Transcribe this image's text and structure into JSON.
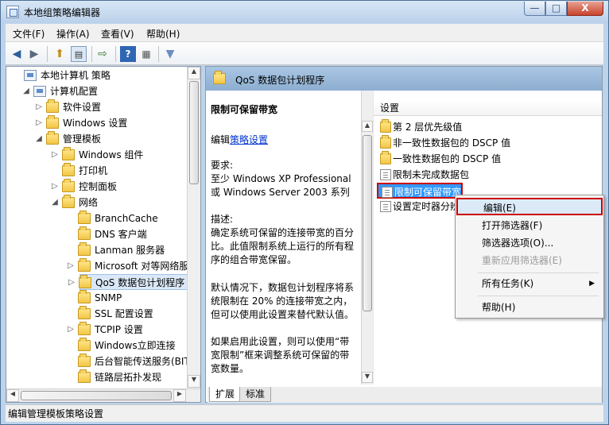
{
  "window": {
    "title": "本地组策略编辑器",
    "min_glyph": "—",
    "max_glyph": "□",
    "close_glyph": "X"
  },
  "menu": [
    "文件(F)",
    "操作(A)",
    "查看(V)",
    "帮助(H)"
  ],
  "toolbar": {
    "icons": [
      "back-arrow-icon",
      "forward-arrow-icon",
      "folder-up-icon",
      "show-hide-tree-icon",
      "export-list-icon",
      "help-icon",
      "properties-pane-icon",
      "filter-icon"
    ]
  },
  "tree": [
    {
      "label": "本地计算机 策略",
      "icon": "computer-icon",
      "expander": "",
      "level": 0
    },
    {
      "label": "计算机配置",
      "icon": "computer-icon",
      "expander": "◢",
      "level": 1
    },
    {
      "label": "软件设置",
      "icon": "folder-icon",
      "expander": "▷",
      "level": 2
    },
    {
      "label": "Windows 设置",
      "icon": "folder-icon",
      "expander": "▷",
      "level": 2
    },
    {
      "label": "管理模板",
      "icon": "folder-icon",
      "expander": "◢",
      "level": 2
    },
    {
      "label": "Windows 组件",
      "icon": "folder-icon",
      "expander": "▷",
      "level": 3
    },
    {
      "label": "打印机",
      "icon": "folder-icon",
      "expander": "",
      "level": 3
    },
    {
      "label": "控制面板",
      "icon": "folder-icon",
      "expander": "▷",
      "level": 3
    },
    {
      "label": "网络",
      "icon": "folder-icon",
      "expander": "◢",
      "level": 3
    },
    {
      "label": "BranchCache",
      "icon": "folder-icon",
      "expander": "",
      "level": 4
    },
    {
      "label": "DNS 客户端",
      "icon": "folder-icon",
      "expander": "",
      "level": 4
    },
    {
      "label": "Lanman 服务器",
      "icon": "folder-icon",
      "expander": "",
      "level": 4
    },
    {
      "label": "Microsoft 对等网络服务",
      "icon": "folder-icon",
      "expander": "▷",
      "level": 4
    },
    {
      "label": "QoS 数据包计划程序",
      "icon": "folder-icon",
      "expander": "▷",
      "level": 4,
      "selected": true
    },
    {
      "label": "SNMP",
      "icon": "folder-icon",
      "expander": "",
      "level": 4
    },
    {
      "label": "SSL 配置设置",
      "icon": "folder-icon",
      "expander": "",
      "level": 4
    },
    {
      "label": "TCPIP 设置",
      "icon": "folder-icon",
      "expander": "▷",
      "level": 4
    },
    {
      "label": "Windows立即连接",
      "icon": "folder-icon",
      "expander": "",
      "level": 4
    },
    {
      "label": "后台智能传送服务(BITS)",
      "icon": "folder-icon",
      "expander": "",
      "level": 4
    },
    {
      "label": "链路层拓扑发现",
      "icon": "folder-icon",
      "expander": "",
      "level": 4
    }
  ],
  "right_header": {
    "title": "QoS 数据包计划程序"
  },
  "description": {
    "title": "限制可保留带宽",
    "edit_prefix": "编辑",
    "edit_link": "策略设置",
    "requirement_label": "要求:",
    "requirement_text": "至少 Windows XP Professional 或 Windows Server 2003 系列",
    "desc_label": "描述:",
    "desc_text": "确定系统可保留的连接带宽的百分比。此值限制系统上运行的所有程序的组合带宽保留。",
    "default_text": "默认情况下，数据包计划程序将系统限制在 20% 的连接带宽之内，但可以使用此设置来替代默认值。",
    "enable_text": "如果启用此设置，则可以使用“带宽限制”框来调整系统可保留的带宽数量。"
  },
  "list": {
    "header": "设置",
    "rows": [
      {
        "label": "第 2 层优先级值",
        "icon": "folder-icon"
      },
      {
        "label": "非一致性数据包的 DSCP 值",
        "icon": "folder-icon"
      },
      {
        "label": "一致性数据包的 DSCP 值",
        "icon": "folder-icon"
      },
      {
        "label": "限制未完成数据包",
        "icon": "policy-icon"
      },
      {
        "label": "限制可保留带宽",
        "icon": "policy-icon",
        "selected": true
      },
      {
        "label": "设置定时器分辨率",
        "icon": "policy-icon"
      }
    ]
  },
  "context_menu": {
    "items": [
      {
        "label": "编辑(E)",
        "disabled": false,
        "highlighted": true
      },
      {
        "label": "打开筛选器(F)",
        "disabled": false
      },
      {
        "label": "筛选器选项(O)...",
        "disabled": false
      },
      {
        "label": "重新应用筛选器(E)",
        "disabled": true
      },
      {
        "label": "所有任务(K)",
        "disabled": false,
        "submenu": true
      },
      {
        "label": "帮助(H)",
        "disabled": false
      }
    ]
  },
  "tabs": [
    "扩展",
    "标准"
  ],
  "status": "编辑管理模板策略设置"
}
